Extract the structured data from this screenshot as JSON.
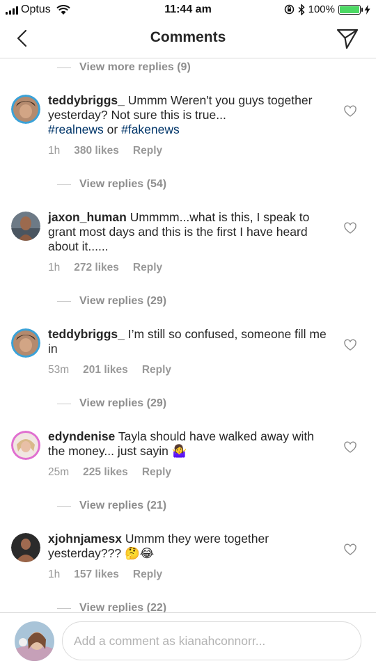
{
  "status_bar": {
    "carrier": "Optus",
    "time": "11:44 am",
    "battery_percent": "100%",
    "battery_level": 1.0,
    "icons": [
      "signal-icon",
      "wifi-icon",
      "orientation-lock-icon",
      "bluetooth-icon",
      "battery-icon",
      "charging-icon"
    ]
  },
  "header": {
    "title": "Comments",
    "back_icon": "chevron-left-icon",
    "send_icon": "direct-send-icon"
  },
  "colors": {
    "hashtag": "#003569",
    "secondary_text": "#999999",
    "divider": "#dbdbdb",
    "battery_green": "#4cd964"
  },
  "top_view_more": "View more replies (9)",
  "comments": [
    {
      "username": "teddybriggs_",
      "text": "Ummm Weren't you guys together yesterday? Not sure this is true...",
      "hashtags": [
        "#realnews",
        "#fakenews"
      ],
      "hashtag_joiner": "or",
      "time": "1h",
      "likes": "380 likes",
      "reply": "Reply",
      "view_replies": "View replies (54)"
    },
    {
      "username": "jaxon_human",
      "text": "Ummmm...what is this, I speak to grant most days and this is the first I have heard about it......",
      "time": "1h",
      "likes": "272 likes",
      "reply": "Reply",
      "view_replies": "View replies (29)"
    },
    {
      "username": "teddybriggs_",
      "text": "I’m still so confused, someone fill me in",
      "time": "53m",
      "likes": "201 likes",
      "reply": "Reply",
      "view_replies": "View replies (29)"
    },
    {
      "username": "edyndenise",
      "text": "Tayla should have walked away with the money... just sayin",
      "emoji": "🤷‍♀️",
      "time": "25m",
      "likes": "225 likes",
      "reply": "Reply",
      "view_replies": "View replies (21)"
    },
    {
      "username": "xjohnjamesx",
      "text": "Ummm they were together yesterday???",
      "emoji": "🤔😂",
      "time": "1h",
      "likes": "157 likes",
      "reply": "Reply",
      "view_replies": "View replies (22)"
    }
  ],
  "composer": {
    "placeholder": "Add a comment as kianahconnorr..."
  }
}
